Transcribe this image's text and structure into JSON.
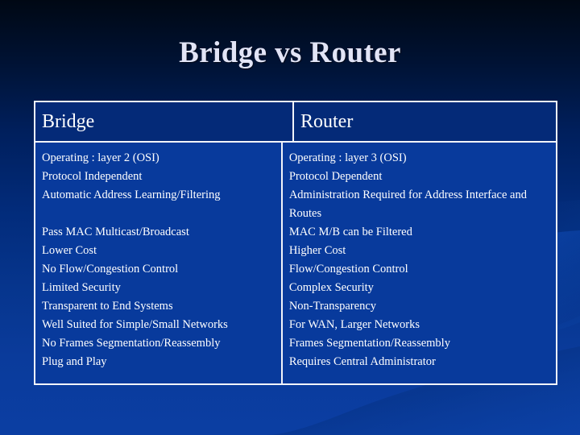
{
  "slide": {
    "title": "Bridge vs Router",
    "background": {
      "gradient_top": "#000814",
      "gradient_bottom": "#0b3ea3",
      "accent_swoosh": "#0d46ad"
    }
  },
  "table": {
    "border_color": "#f2f4fa",
    "header_background": "#042a78",
    "body_background": "#083a9c",
    "text_color": "#ffffff",
    "columns": [
      {
        "header": "Bridge",
        "items": [
          "Operating : layer 2 (OSI)",
          "Protocol Independent",
          "Automatic Address Learning/Filtering",
          "",
          "Pass MAC Multicast/Broadcast",
          "Lower Cost",
          "No Flow/Congestion Control",
          "Limited Security",
          "Transparent to End Systems",
          "Well Suited for Simple/Small Networks",
          "No Frames Segmentation/Reassembly",
          "Plug and Play"
        ]
      },
      {
        "header": "Router",
        "items": [
          "Operating : layer 3 (OSI)",
          "Protocol Dependent",
          "Administration Required for Address Interface and Routes",
          "MAC M/B can be Filtered",
          "Higher Cost",
          "Flow/Congestion Control",
          "Complex Security",
          "Non-Transparency",
          "For WAN, Larger Networks",
          "Frames Segmentation/Reassembly",
          "Requires Central Administrator"
        ]
      }
    ]
  }
}
